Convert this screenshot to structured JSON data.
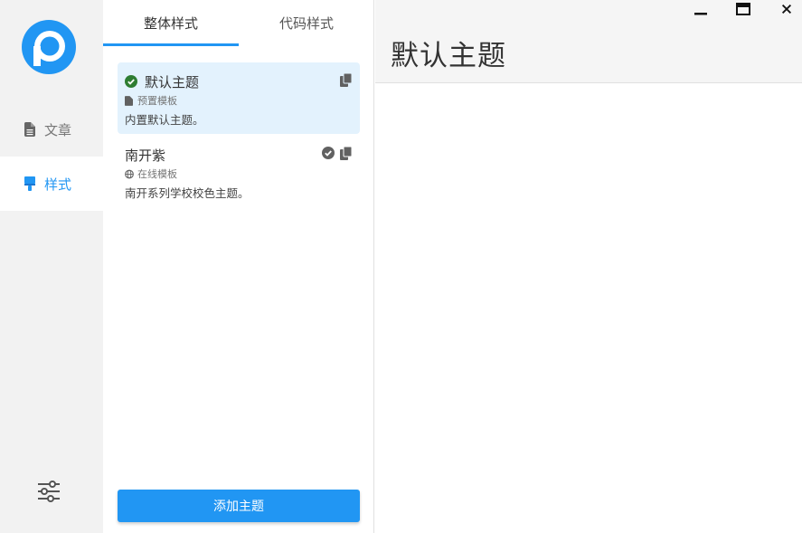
{
  "nav": {
    "articles_label": "文章",
    "styles_label": "样式"
  },
  "tabs": {
    "overall": "整体样式",
    "code": "代码样式"
  },
  "themes": [
    {
      "name": "默认主题",
      "type": "预置模板",
      "description": "内置默认主题。",
      "active": true
    },
    {
      "name": "南开紫",
      "type": "在线模板",
      "description": "南开系列学校校色主题。",
      "active": false
    }
  ],
  "add_button": "添加主题",
  "preview": {
    "title": "默认主题"
  },
  "colors": {
    "accent": "#2196f3",
    "success": "#2e7d32",
    "selected_bg": "#e3f2fd"
  }
}
